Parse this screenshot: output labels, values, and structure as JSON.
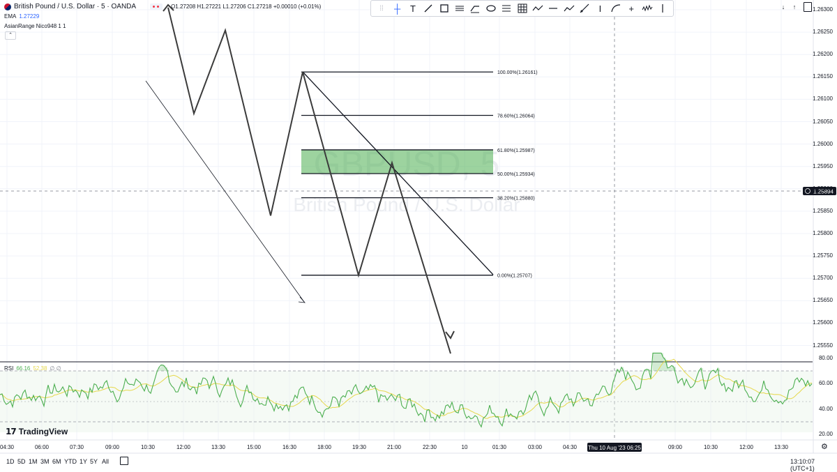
{
  "header": {
    "symbol_line": "British Pound / U.S. Dollar · 5 · OANDA",
    "ohlc": "O1.27208 H1.27221 L1.27206 C1.27218 +0.00010 (+0.01%)",
    "ema_label": "EMA",
    "ema_value": "1.27229",
    "asian_label": "AsianRange Nico948 1 1"
  },
  "watermark": {
    "ticker": "GBPUSD, 5",
    "name": "British Pound / U.S. Dollar"
  },
  "toolbar": {
    "tools": [
      "drag-handle",
      "crosshair",
      "text",
      "trend-line",
      "rectangle",
      "parallel-channel",
      "brush",
      "ellipse",
      "fib-retracement",
      "grid",
      "path",
      "horizontal-line",
      "polyline",
      "ray",
      "info-line",
      "curve",
      "cross-line",
      "cluster",
      "vertical-line"
    ]
  },
  "price_axis": {
    "labels": [
      "1.26300",
      "1.26250",
      "1.26200",
      "1.26150",
      "1.26100",
      "1.26050",
      "1.26000",
      "1.25950",
      "1.25900",
      "1.25850",
      "1.25800",
      "1.25750",
      "1.25700",
      "1.25650",
      "1.25600",
      "1.25550"
    ],
    "current_price": "1.25894"
  },
  "rsi": {
    "label": "RSI",
    "value": "66.16",
    "value2": "52.38",
    "extra": "∅ ∅",
    "axis": [
      "80.00",
      "60.00",
      "40.00",
      "20.00"
    ],
    "upper": 70,
    "lower": 30
  },
  "time_axis": {
    "labels": [
      "04:30",
      "06:00",
      "07:30",
      "09:00",
      "10:30",
      "12:00",
      "13:30",
      "15:00",
      "16:30",
      "18:00",
      "19:30",
      "21:00",
      "22:30",
      "10",
      "01:30",
      "03:00",
      "04:30",
      "Thu 10 Aug '23",
      "06:25",
      "09:00",
      "10:30",
      "12:00",
      "13:30"
    ],
    "crosshair_label": "Thu 10 Aug '23   06:25"
  },
  "fib": {
    "levels": [
      {
        "label": "100.00%(1.26161)",
        "price": 1.26161
      },
      {
        "label": "78.60%(1.26064)",
        "price": 1.26064
      },
      {
        "label": "61.80%(1.25987)",
        "price": 1.25987
      },
      {
        "label": "50.00%(1.25934)",
        "price": 1.25934
      },
      {
        "label": "38.20%(1.25880)",
        "price": 1.2588
      },
      {
        "label": "0.00%(1.25707)",
        "price": 1.25707
      }
    ]
  },
  "zigzag_prices": [
    1.26305,
    1.26068,
    1.26254,
    1.2584,
    1.26161,
    1.25707,
    1.25958,
    1.25532
  ],
  "bottom_bar": {
    "timeframes": [
      "1D",
      "5D",
      "1M",
      "3M",
      "6M",
      "YTD",
      "1Y",
      "5Y",
      "All"
    ],
    "clock": "13:10:07 (UTC+1)"
  },
  "branding": {
    "logo_text": "TradingView"
  },
  "colors": {
    "fib_zone": "#4caf50",
    "rsi_line": "#4caf50",
    "rsi_ma": "#e6d84c",
    "crosshair_tag": "#131722"
  },
  "chart_data": {
    "type": "line",
    "series": [],
    "ylim": [
      1.2553,
      1.263
    ]
  }
}
